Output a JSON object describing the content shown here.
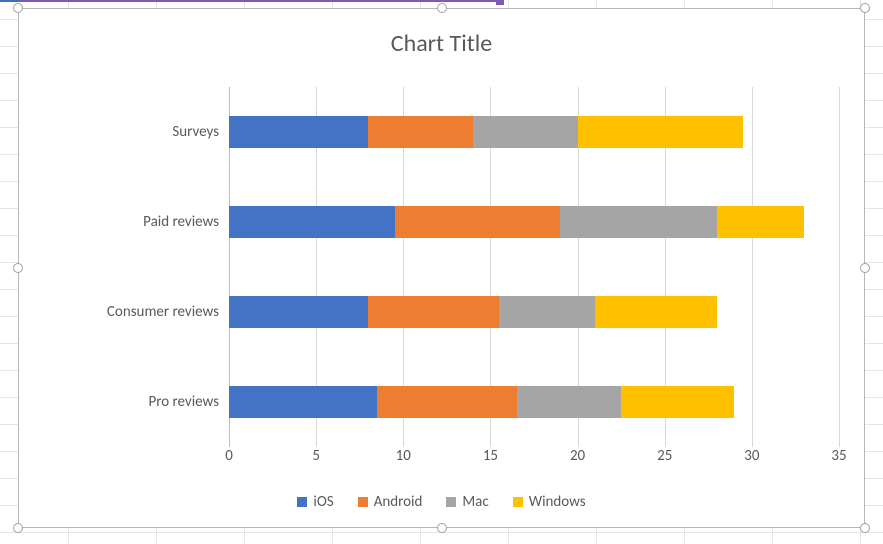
{
  "chart": {
    "title": "Chart Title",
    "legend": {
      "items": [
        {
          "name": "iOS",
          "color": "#4472c4"
        },
        {
          "name": "Android",
          "color": "#ed7d31"
        },
        {
          "name": "Mac",
          "color": "#a5a5a5"
        },
        {
          "name": "Windows",
          "color": "#ffc000"
        }
      ]
    },
    "xaxis": {
      "ticks": [
        "0",
        "5",
        "10",
        "15",
        "20",
        "25",
        "30",
        "35"
      ]
    },
    "yaxis": {
      "labels": [
        "Surveys",
        "Paid reviews",
        "Consumer reviews",
        "Pro reviews"
      ]
    }
  },
  "chart_data": {
    "type": "bar",
    "orientation": "horizontal",
    "stacked": true,
    "title": "Chart Title",
    "xlabel": "",
    "ylabel": "",
    "xlim": [
      0,
      35
    ],
    "categories": [
      "Pro reviews",
      "Consumer reviews",
      "Paid reviews",
      "Surveys"
    ],
    "series": [
      {
        "name": "iOS",
        "color": "#4472c4",
        "values": [
          8.5,
          8.0,
          9.5,
          8.0
        ]
      },
      {
        "name": "Android",
        "color": "#ed7d31",
        "values": [
          8.0,
          7.5,
          9.5,
          6.0
        ]
      },
      {
        "name": "Mac",
        "color": "#a5a5a5",
        "values": [
          6.0,
          5.5,
          9.0,
          6.0
        ]
      },
      {
        "name": "Windows",
        "color": "#ffc000",
        "values": [
          6.5,
          7.0,
          5.0,
          9.5
        ]
      }
    ],
    "legend_position": "bottom",
    "grid": true
  }
}
